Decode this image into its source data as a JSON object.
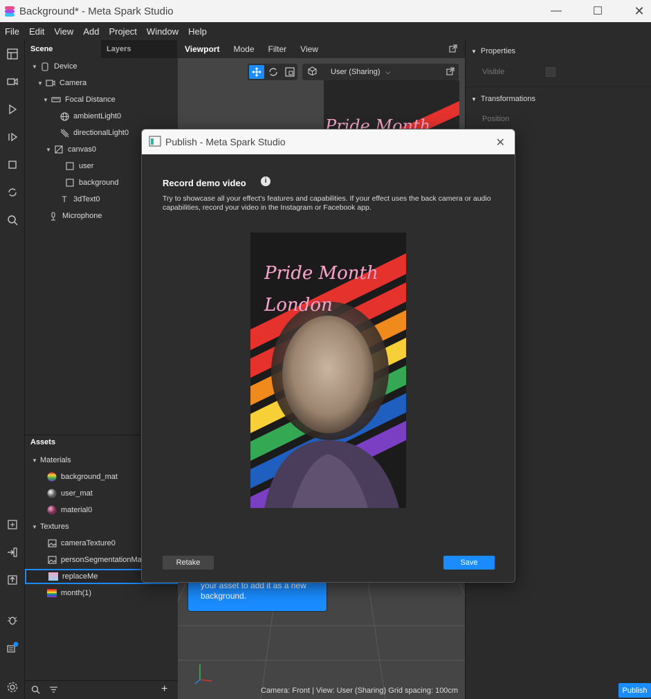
{
  "window": {
    "title": "Background* - Meta Spark Studio",
    "minimize_icon": "minimize-icon",
    "maximize_icon": "maximize-icon",
    "close_icon": "close-icon"
  },
  "menu": [
    "File",
    "Edit",
    "View",
    "Add",
    "Project",
    "Window",
    "Help"
  ],
  "scene_panel": {
    "tabs": [
      "Scene",
      "Layers"
    ],
    "tree": [
      {
        "label": "Device",
        "icon": "device-icon"
      },
      {
        "label": "Camera",
        "icon": "camera-icon"
      },
      {
        "label": "Focal Distance",
        "icon": "focal-distance-icon"
      },
      {
        "label": "ambientLight0",
        "icon": "ambient-light-icon"
      },
      {
        "label": "directionalLight0",
        "icon": "directional-light-icon"
      },
      {
        "label": "canvas0",
        "icon": "canvas-icon"
      },
      {
        "label": "user",
        "icon": "rectangle-icon"
      },
      {
        "label": "background",
        "icon": "rectangle-icon"
      },
      {
        "label": "3dText0",
        "icon": "text-icon"
      },
      {
        "label": "Microphone",
        "icon": "microphone-icon"
      }
    ]
  },
  "assets_panel": {
    "title": "Assets",
    "groups": [
      {
        "label": "Materials",
        "items": [
          "background_mat",
          "user_mat",
          "material0"
        ]
      },
      {
        "label": "Textures",
        "items": [
          "cameraTexture0",
          "personSegmentationMa",
          "replaceMe",
          "month(1)"
        ]
      }
    ],
    "selected_item": "replaceMe"
  },
  "viewport": {
    "tabs": [
      "Viewport",
      "Mode",
      "Filter",
      "View"
    ],
    "view_dropdown": "User (Sharing)",
    "status": "Camera: Front | View: User (Sharing)  Grid spacing: 100cm",
    "tooltip_text": "your asset to add it as a new background.",
    "preview_title": "Pride Month"
  },
  "right_panel": {
    "sections": [
      "Properties",
      "Transformations"
    ],
    "visible_label": "Visible",
    "position_label": "Position"
  },
  "dialog": {
    "title": "Publish - Meta Spark Studio",
    "heading": "Record demo video",
    "description": "Try to showcase all your effect's features and capabilities. If your effect uses the back camera or audio capabilities, record your video in the Instagram or Facebook app.",
    "video_text_line1": "Pride Month",
    "video_text_line2": "London",
    "retake_label": "Retake",
    "save_label": "Save"
  },
  "bottom": {
    "publish_label": "Publish"
  },
  "colors": {
    "accent": "#1a8cff",
    "rainbow": [
      "#e5322d",
      "#f08a1c",
      "#f7d038",
      "#34a853",
      "#1e5fbf",
      "#7b3fc4"
    ]
  }
}
